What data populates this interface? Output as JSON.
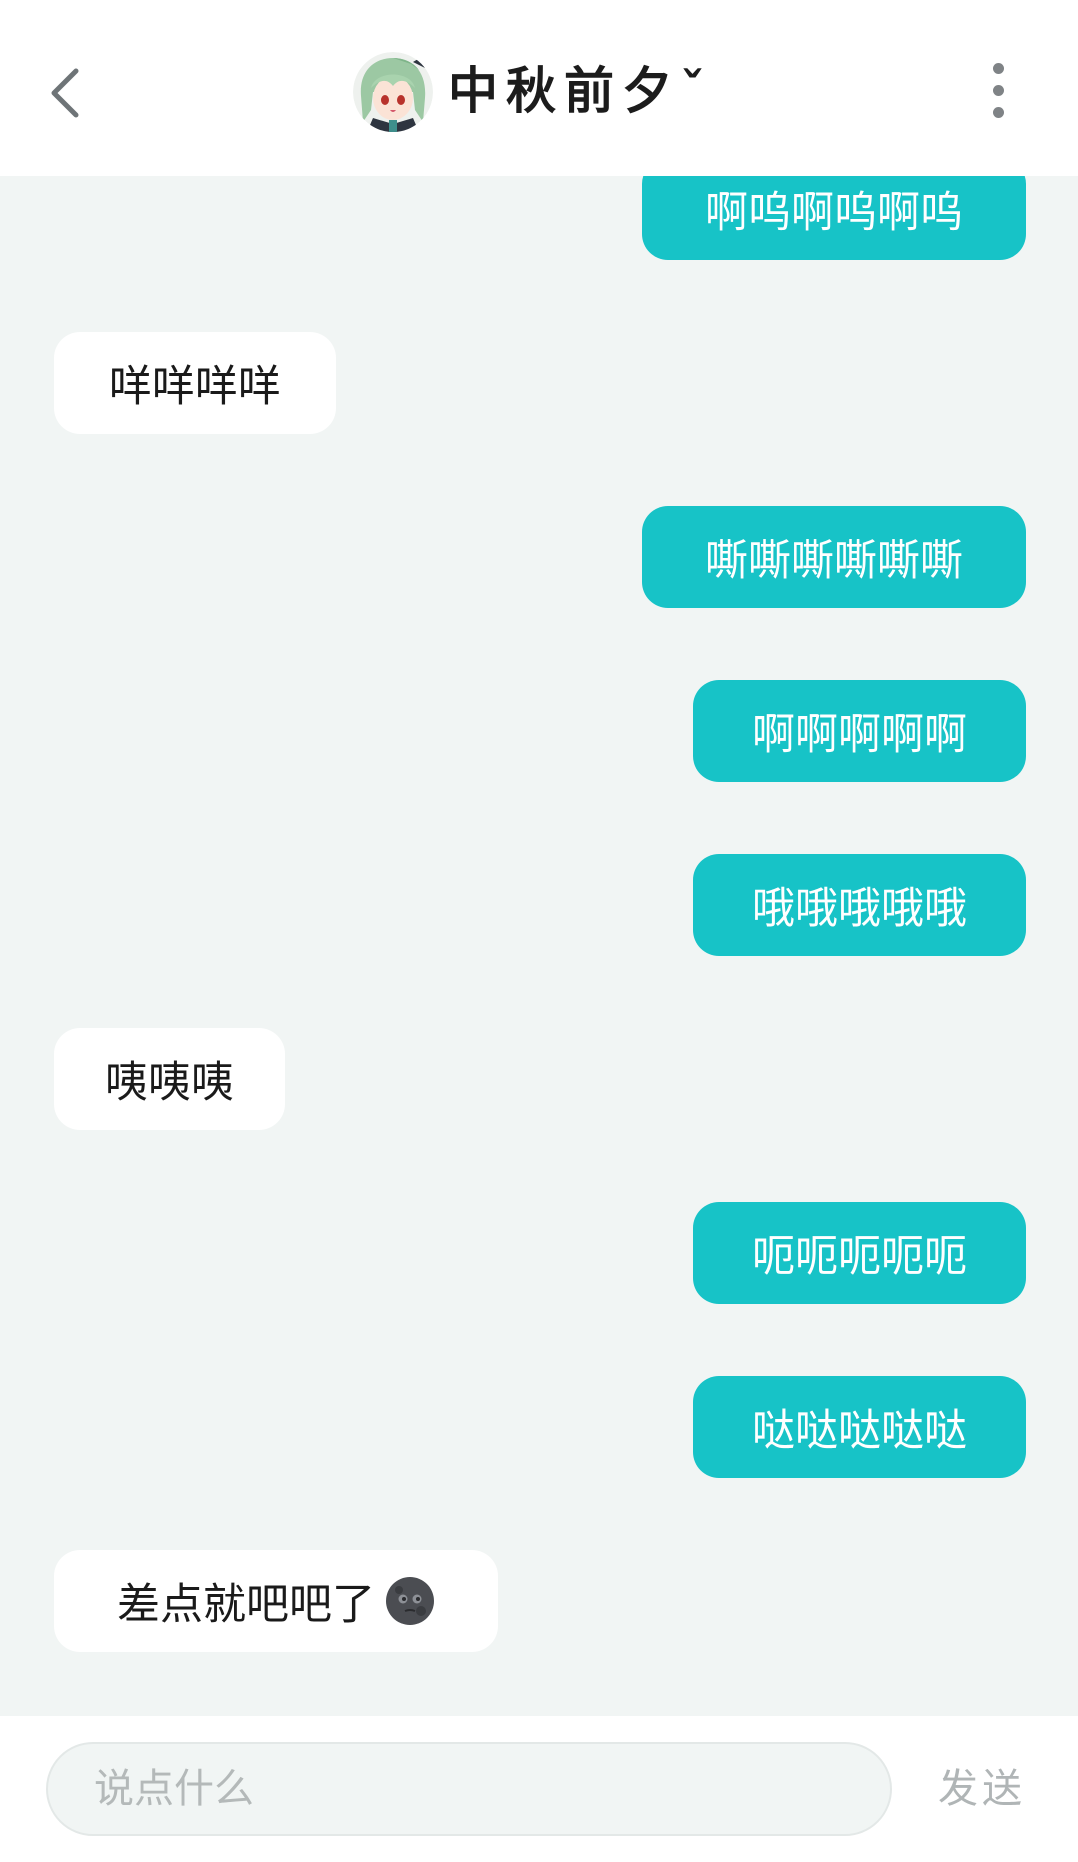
{
  "header": {
    "title": "中秋前夕ˇ",
    "back_icon": "chevron-left-icon",
    "more_icon": "more-vertical-icon",
    "avatar": "anime-avatar"
  },
  "colors": {
    "outgoing_bubble": "#17c3c7",
    "incoming_bubble": "#ffffff",
    "chat_background": "#f1f5f4"
  },
  "messages": [
    {
      "direction": "out",
      "text": "啊呜啊呜啊呜"
    },
    {
      "direction": "in",
      "text": "咩咩咩咩"
    },
    {
      "direction": "out",
      "text": "嘶嘶嘶嘶嘶嘶"
    },
    {
      "direction": "out",
      "text": "啊啊啊啊啊"
    },
    {
      "direction": "out",
      "text": "哦哦哦哦哦"
    },
    {
      "direction": "in",
      "text": "咦咦咦"
    },
    {
      "direction": "out",
      "text": "呃呃呃呃呃"
    },
    {
      "direction": "out",
      "text": "哒哒哒哒哒"
    },
    {
      "direction": "in",
      "text": "差点就吧吧了",
      "emoji": "new-moon-face-emoji"
    }
  ],
  "composer": {
    "placeholder": "说点什么",
    "send_label": "发送"
  }
}
